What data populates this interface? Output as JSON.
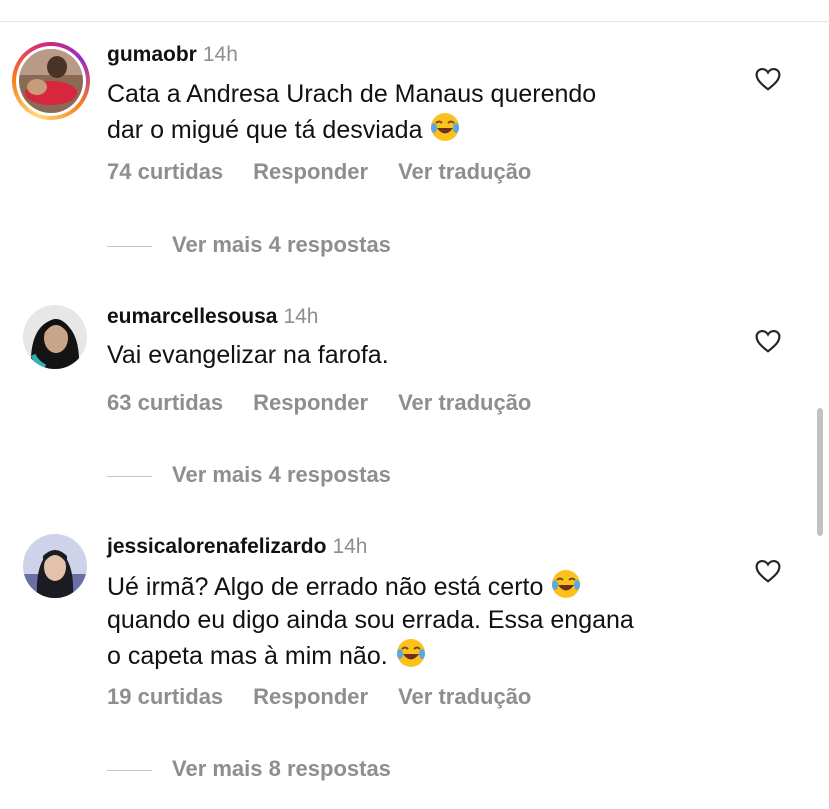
{
  "comments": [
    {
      "username": "gumaobr",
      "time": "14h",
      "text_parts": [
        "Cata a Andresa Urach de Manaus querendo",
        "dar o migué que tá desviada"
      ],
      "likes": "74 curtidas",
      "reply": "Responder",
      "translate": "Ver tradução",
      "more_replies": "Ver mais 4 respostas"
    },
    {
      "username": "eumarcellesousa",
      "time": "14h",
      "text_parts": [
        "Vai evangelizar na farofa."
      ],
      "likes": "63 curtidas",
      "reply": "Responder",
      "translate": "Ver tradução",
      "more_replies": "Ver mais 4 respostas"
    },
    {
      "username": "jessicalorenafelizardo",
      "time": "14h",
      "text_parts": [
        "Ué irmã? Algo de errado não está certo",
        "quando eu digo ainda sou errada. Essa engana",
        "o capeta mas à mim não."
      ],
      "likes": "19 curtidas",
      "reply": "Responder",
      "translate": "Ver tradução",
      "more_replies": "Ver mais 8 respostas"
    }
  ],
  "icons": {
    "like": "heart-outline-icon",
    "emoji": "face-with-tears-of-joy-emoji"
  },
  "colors": {
    "secondary_text": "#8e8e8e",
    "primary_text": "#111111",
    "story_ring": "#d62976"
  }
}
